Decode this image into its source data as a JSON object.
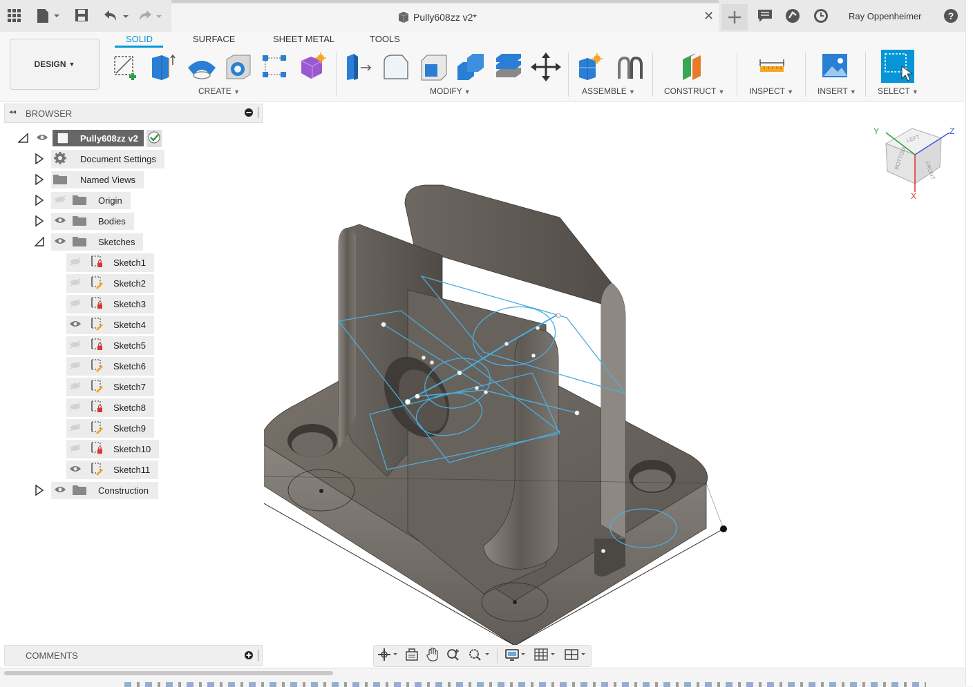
{
  "window": {
    "doc_title": "Pully608zz v2*",
    "user_name": "Ray Oppenheimer"
  },
  "toolbar": {
    "tabs": [
      "SOLID",
      "SURFACE",
      "SHEET METAL",
      "TOOLS"
    ],
    "active_tab": "SOLID",
    "workspace": "DESIGN",
    "groups": [
      "CREATE",
      "MODIFY",
      "ASSEMBLE",
      "CONSTRUCT",
      "INSPECT",
      "INSERT",
      "SELECT"
    ]
  },
  "browser": {
    "title": "BROWSER",
    "root": "Pully608zz v2",
    "items": [
      {
        "label": "Document Settings"
      },
      {
        "label": "Named Views"
      },
      {
        "label": "Origin"
      },
      {
        "label": "Bodies"
      },
      {
        "label": "Sketches"
      },
      {
        "label": "Construction"
      }
    ],
    "sketches": [
      {
        "label": "Sketch1",
        "visible": false,
        "locked": true
      },
      {
        "label": "Sketch2",
        "visible": false,
        "locked": false
      },
      {
        "label": "Sketch3",
        "visible": false,
        "locked": true
      },
      {
        "label": "Sketch4",
        "visible": true,
        "locked": false
      },
      {
        "label": "Sketch5",
        "visible": false,
        "locked": true
      },
      {
        "label": "Sketch6",
        "visible": false,
        "locked": false
      },
      {
        "label": "Sketch7",
        "visible": false,
        "locked": false
      },
      {
        "label": "Sketch8",
        "visible": false,
        "locked": true
      },
      {
        "label": "Sketch9",
        "visible": false,
        "locked": false
      },
      {
        "label": "Sketch10",
        "visible": false,
        "locked": true
      },
      {
        "label": "Sketch11",
        "visible": true,
        "locked": false
      }
    ]
  },
  "viewcube": {
    "faces": [
      "LEFT",
      "FRONT",
      "BOTTOM"
    ],
    "axes": [
      "Y",
      "Z",
      "X"
    ]
  },
  "comments": {
    "title": "COMMENTS"
  },
  "colors": {
    "accent": "#0696d7",
    "model": "#5e5953",
    "sketch": "#4aaede"
  }
}
